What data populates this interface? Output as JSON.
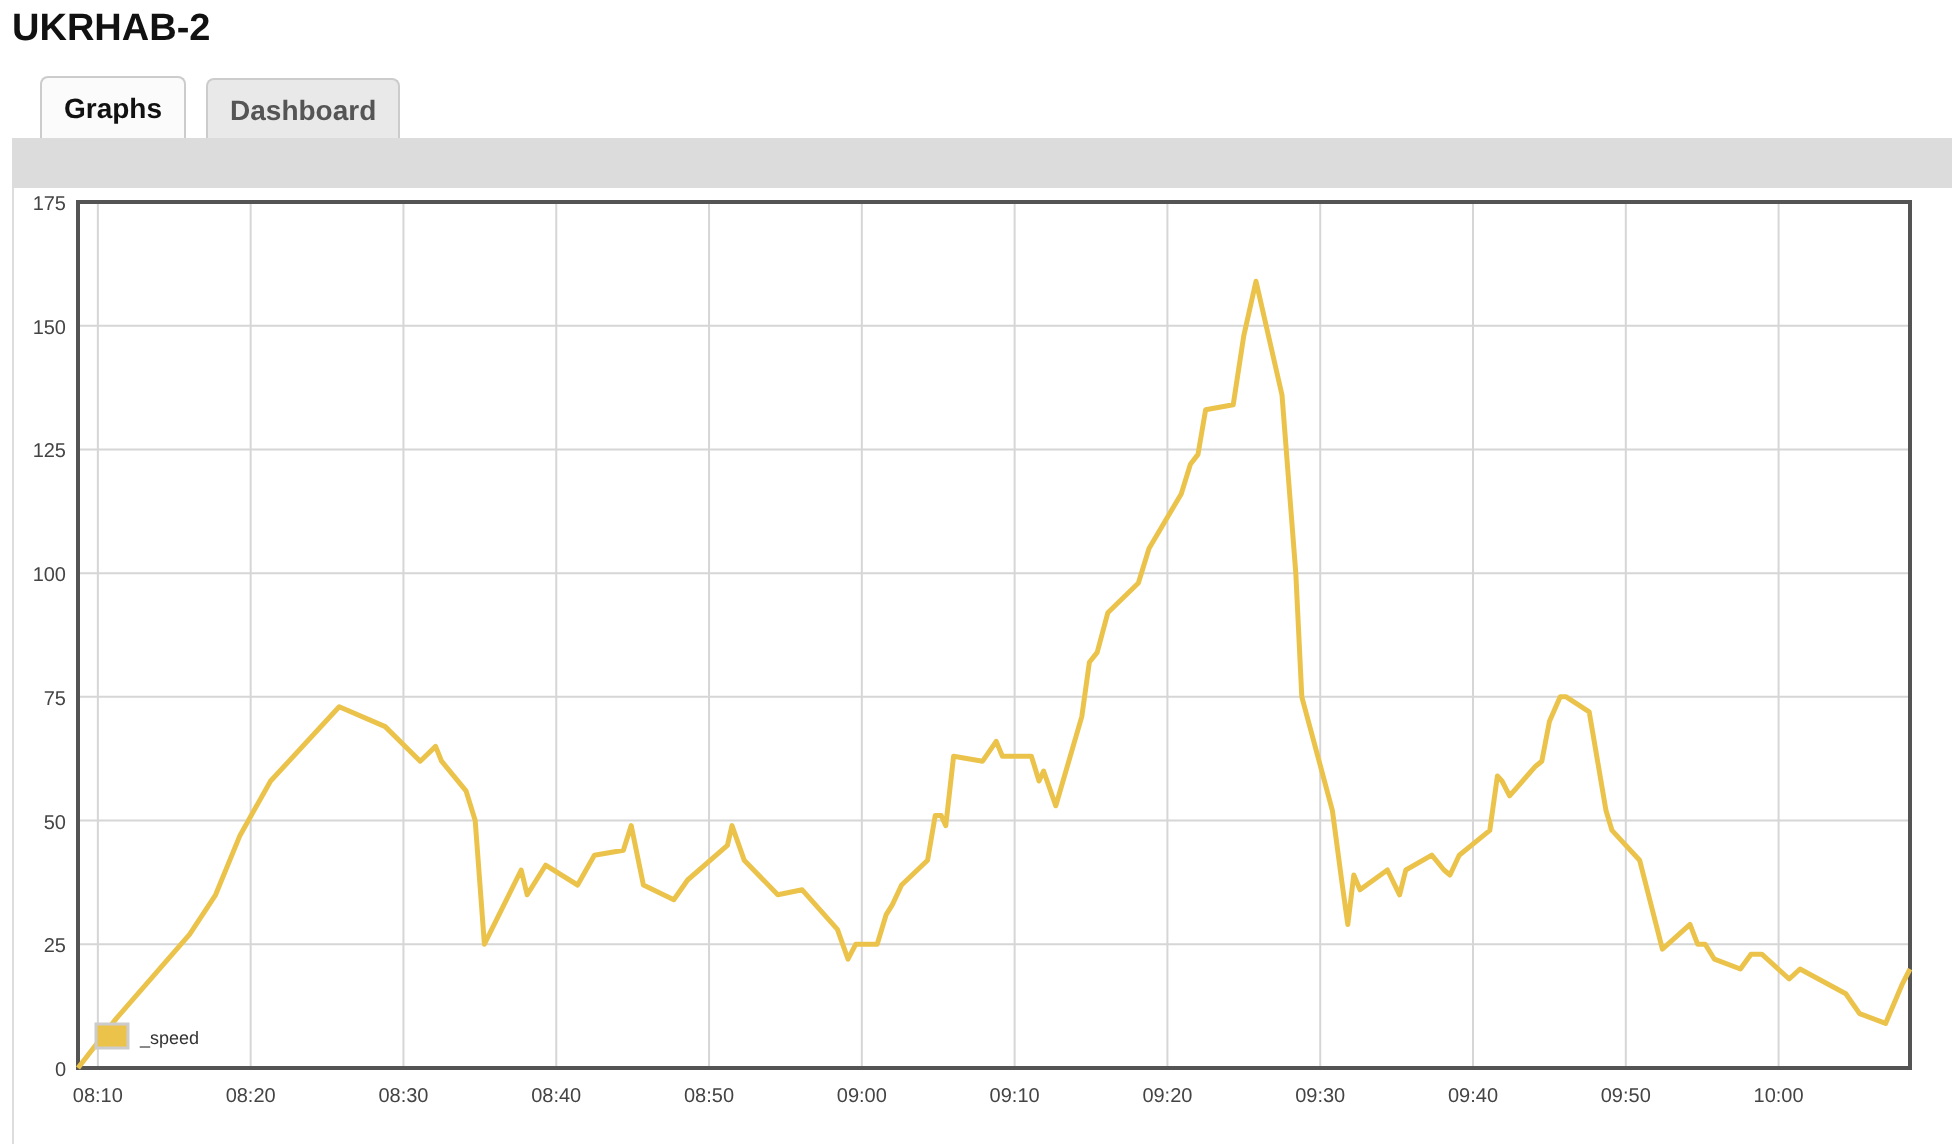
{
  "title": "UKRHAB-2",
  "tabs": [
    {
      "label": "Graphs",
      "selected": true
    },
    {
      "label": "Dashboard",
      "selected": false
    }
  ],
  "chart_data": {
    "type": "line",
    "grid": true,
    "xlim": [
      488.7,
      608.6
    ],
    "ylim": [
      0,
      175
    ],
    "xticks": [
      {
        "value": 490,
        "label": "08:10"
      },
      {
        "value": 500,
        "label": "08:20"
      },
      {
        "value": 510,
        "label": "08:30"
      },
      {
        "value": 520,
        "label": "08:40"
      },
      {
        "value": 530,
        "label": "08:50"
      },
      {
        "value": 540,
        "label": "09:00"
      },
      {
        "value": 550,
        "label": "09:10"
      },
      {
        "value": 560,
        "label": "09:20"
      },
      {
        "value": 570,
        "label": "09:30"
      },
      {
        "value": 580,
        "label": "09:40"
      },
      {
        "value": 590,
        "label": "09:50"
      },
      {
        "value": 600,
        "label": "10:00"
      }
    ],
    "yticks": [
      0,
      25,
      50,
      75,
      100,
      125,
      150,
      175
    ],
    "x": [
      488.7,
      491.2,
      496,
      497.7,
      499.3,
      501.3,
      505.8,
      508.8,
      511.1,
      512.1,
      512.5,
      514.1,
      514.7,
      515.3,
      517.7,
      518.1,
      519.3,
      521.4,
      522.5,
      524.4,
      524.9,
      525.7,
      527.7,
      528.6,
      531.2,
      531.5,
      532.3,
      534.5,
      536.1,
      538.4,
      539.1,
      539.6,
      541.0,
      541.6,
      542.0,
      542.6,
      544.3,
      544.8,
      545.2,
      545.5,
      546.0,
      547.9,
      548.8,
      549.2,
      551.1,
      551.6,
      551.9,
      552.7,
      554.4,
      554.9,
      555.4,
      556.1,
      558.1,
      558.8,
      560.9,
      561.5,
      562.0,
      562.5,
      564.3,
      565.0,
      565.8,
      567.5,
      568.4,
      568.8,
      570.8,
      571.4,
      571.8,
      572.2,
      572.6,
      574.4,
      575.2,
      575.6,
      577.3,
      578.1,
      578.5,
      579.1,
      581.1,
      581.6,
      581.9,
      582.4,
      584.1,
      584.5,
      585.0,
      585.7,
      586.1,
      587.6,
      588.7,
      589.1,
      590.9,
      592.4,
      594.2,
      594.7,
      595.2,
      595.8,
      597.5,
      598.2,
      598.9,
      600.7,
      601.4,
      604.4,
      605.3,
      607.0,
      608.1,
      608.6
    ],
    "series": [
      {
        "name": "_speed",
        "color": "#ebc34b",
        "values": [
          0,
          10,
          27,
          35,
          47,
          58,
          73,
          69,
          62,
          65,
          62,
          56,
          50,
          25,
          40,
          35,
          41,
          37,
          43,
          44,
          49,
          37,
          34,
          38,
          45,
          49,
          42,
          35,
          36,
          28,
          22,
          25,
          25,
          31,
          33,
          37,
          42,
          51,
          51,
          49,
          63,
          62,
          66,
          63,
          63,
          58,
          60,
          53,
          71,
          82,
          84,
          92,
          98,
          105,
          116,
          122,
          124,
          133,
          134,
          148,
          159,
          136,
          100,
          75,
          52,
          38,
          29,
          39,
          36,
          40,
          35,
          40,
          43,
          40,
          39,
          43,
          48,
          59,
          58,
          55,
          61,
          62,
          70,
          75,
          75,
          72,
          52,
          48,
          42,
          24,
          29,
          25,
          25,
          22,
          20,
          23,
          23,
          18,
          20,
          15,
          11,
          9,
          17,
          20
        ]
      }
    ]
  }
}
